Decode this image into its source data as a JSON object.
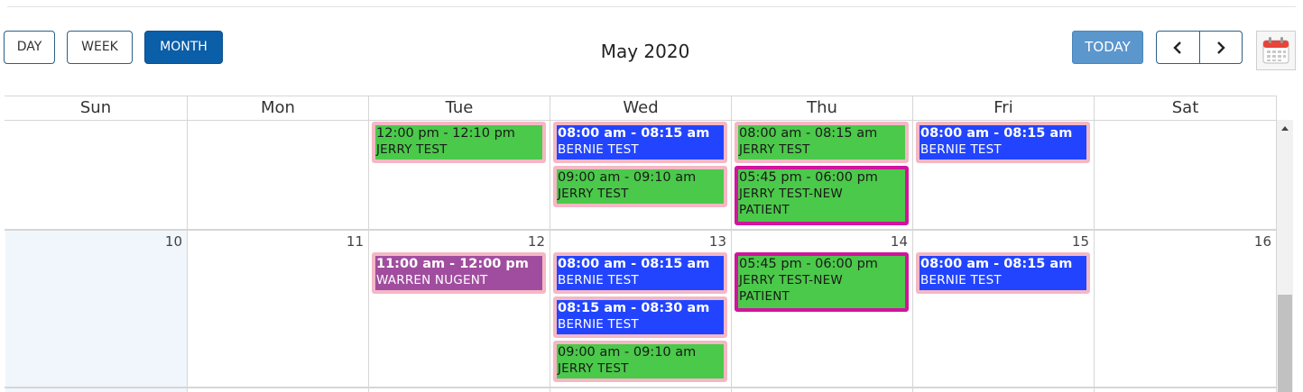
{
  "toolbar": {
    "day_label": "DAY",
    "week_label": "WEEK",
    "month_label": "MONTH",
    "active_view": "MONTH",
    "title": "May 2020",
    "today_label": "TODAY",
    "prev_icon": "chevron-left-icon",
    "next_icon": "chevron-right-icon",
    "calendar_icon": "calendar-icon"
  },
  "weekdays": [
    "Sun",
    "Mon",
    "Tue",
    "Wed",
    "Thu",
    "Fri",
    "Sat"
  ],
  "weeks": [
    {
      "day_numbers": [
        "",
        "",
        "",
        "",
        "",
        "",
        ""
      ],
      "events": [
        {
          "day": "Tue",
          "time": "12:00 pm - 12:10 pm",
          "name": "JERRY TEST",
          "color": "#4bc94a"
        },
        {
          "day": "Wed",
          "time": "08:00 am - 08:15 am",
          "name": "BERNIE TEST",
          "color": "#2244ff"
        },
        {
          "day": "Wed",
          "time": "09:00 am - 09:10 am",
          "name": "JERRY TEST",
          "color": "#4bc94a"
        },
        {
          "day": "Thu",
          "time": "08:00 am - 08:15 am",
          "name": "JERRY TEST",
          "color": "#4bc94a"
        },
        {
          "day": "Thu",
          "time": "05:45 pm - 06:00 pm",
          "name": "JERRY TEST-NEW PATIENT",
          "color": "#4bc94a"
        },
        {
          "day": "Fri",
          "time": "08:00 am - 08:15 am",
          "name": "BERNIE TEST",
          "color": "#2244ff"
        }
      ]
    },
    {
      "day_numbers": [
        "10",
        "11",
        "12",
        "13",
        "14",
        "15",
        "16"
      ],
      "events": [
        {
          "day": "Tue",
          "time": "11:00 am - 12:00 pm",
          "name": "WARREN NUGENT",
          "color": "#a14d9f"
        },
        {
          "day": "Wed",
          "time": "08:00 am - 08:15 am",
          "name": "BERNIE TEST",
          "color": "#2244ff"
        },
        {
          "day": "Wed",
          "time": "08:15 am - 08:30 am",
          "name": "BERNIE TEST",
          "color": "#2244ff"
        },
        {
          "day": "Wed",
          "time": "09:00 am - 09:10 am",
          "name": "JERRY TEST",
          "color": "#4bc94a"
        },
        {
          "day": "Thu",
          "time": "05:45 pm - 06:00 pm",
          "name": "JERRY TEST-NEW PATIENT",
          "color": "#4bc94a"
        },
        {
          "day": "Fri",
          "time": "08:00 am - 08:15 am",
          "name": "BERNIE TEST",
          "color": "#2244ff"
        }
      ]
    }
  ],
  "colors": {
    "accent": "#0b5ea8",
    "today_button": "#5b96cd",
    "event_border": "#f4b8c5",
    "new_patient_border": "#d0149e",
    "today_cell": "#f0f6fc"
  }
}
